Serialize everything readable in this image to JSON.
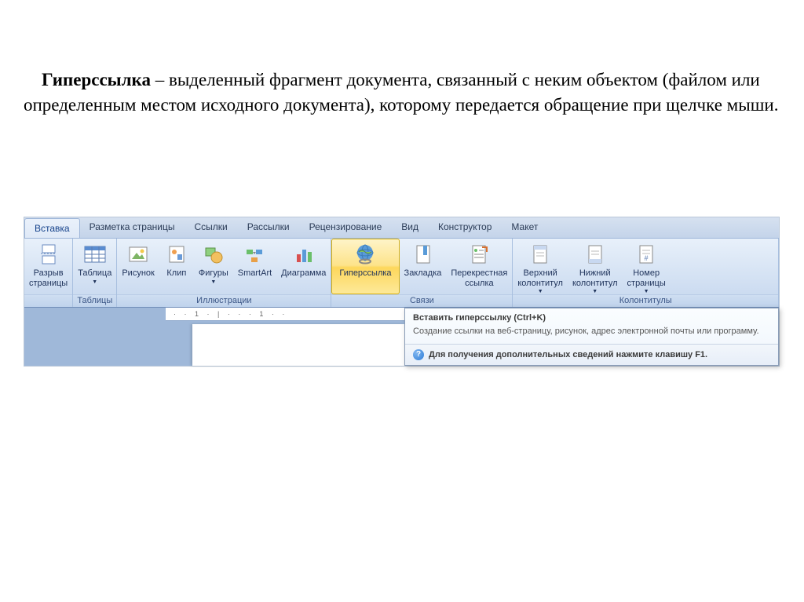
{
  "definition": {
    "bold": "Гиперссылка",
    "rest": " – выделенный фрагмент документа, связанный с неким объектом (файлом или определенным местом исходного документа), которому передается обращение при щелчке мыши."
  },
  "tabs": [
    "Вставка",
    "Разметка страницы",
    "Ссылки",
    "Рассылки",
    "Рецензирование",
    "Вид",
    "Конструктор",
    "Макет"
  ],
  "ribbon": {
    "groups": [
      {
        "label": "",
        "items": [
          {
            "name": "page-break",
            "label": "Разрыв\nстраницы",
            "icon": "page-break"
          }
        ]
      },
      {
        "label": "Таблицы",
        "items": [
          {
            "name": "table",
            "label": "Таблица",
            "icon": "table",
            "dropdown": true
          }
        ]
      },
      {
        "label": "Иллюстрации",
        "items": [
          {
            "name": "picture",
            "label": "Рисунок",
            "icon": "picture"
          },
          {
            "name": "clip",
            "label": "Клип",
            "icon": "clip"
          },
          {
            "name": "shapes",
            "label": "Фигуры",
            "icon": "shapes",
            "dropdown": true
          },
          {
            "name": "smartart",
            "label": "SmartArt",
            "icon": "smartart"
          },
          {
            "name": "chart",
            "label": "Диаграмма",
            "icon": "chart"
          }
        ]
      },
      {
        "label": "Связи",
        "items": [
          {
            "name": "hyperlink",
            "label": "Гиперссылка",
            "icon": "hyperlink",
            "highlighted": true
          },
          {
            "name": "bookmark",
            "label": "Закладка",
            "icon": "bookmark"
          },
          {
            "name": "cross-reference",
            "label": "Перекрестная\nссылка",
            "icon": "cross-ref"
          }
        ]
      },
      {
        "label": "Колонтитулы",
        "items": [
          {
            "name": "header",
            "label": "Верхний\nколонтитул",
            "icon": "header",
            "dropdown": true
          },
          {
            "name": "footer",
            "label": "Нижний\nколонтитул",
            "icon": "footer",
            "dropdown": true
          },
          {
            "name": "page-number",
            "label": "Номер\nстраницы",
            "icon": "page-number",
            "dropdown": true
          }
        ]
      }
    ]
  },
  "ruler": "· · 1 · | · · · 1 · ·",
  "tooltip": {
    "title": "Вставить гиперссылку (Ctrl+K)",
    "body": "Создание ссылки на веб-страницу, рисунок, адрес электронной почты или программу.",
    "footer": "Для получения дополнительных сведений нажмите клавишу F1."
  }
}
